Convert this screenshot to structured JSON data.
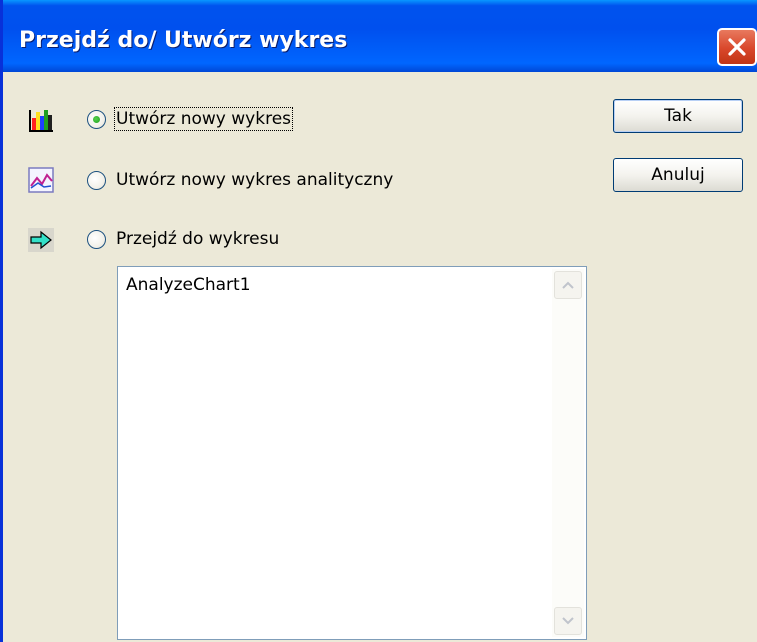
{
  "window": {
    "title": "Przejdź do/ Utwórz wykres",
    "close_icon": "close-icon"
  },
  "options": [
    {
      "label": "Utwórz nowy wykres",
      "icon": "bar-chart-icon",
      "selected": true
    },
    {
      "label": "Utwórz nowy wykres analityczny",
      "icon": "line-chart-icon",
      "selected": false
    },
    {
      "label": "Przejdź do wykresu",
      "icon": "arrow-right-icon",
      "selected": false
    }
  ],
  "buttons": {
    "ok_label": "Tak",
    "cancel_label": "Anuluj"
  },
  "chart_list": {
    "items": [
      "AnalyzeChart1"
    ]
  },
  "colors": {
    "titlebar": "#0054e3",
    "dialog_bg": "#ece9d8",
    "close_button": "#d9472b"
  }
}
